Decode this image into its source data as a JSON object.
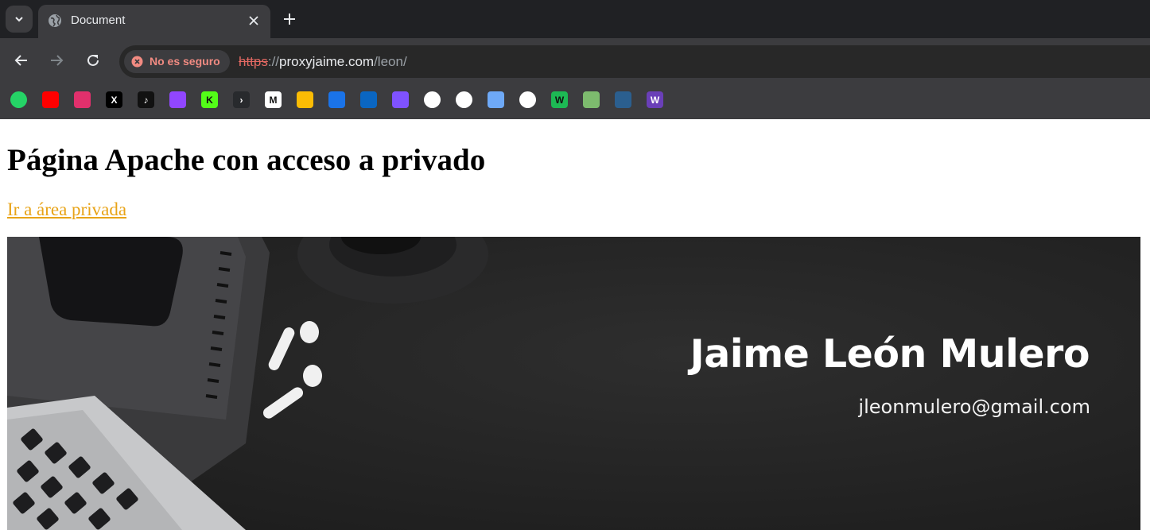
{
  "browser": {
    "tab": {
      "title": "Document"
    },
    "security_chip": {
      "label": "No es seguro"
    },
    "url": {
      "scheme": "https",
      "separator": "://",
      "host": "proxyjaime.com",
      "path": "/leon/"
    },
    "bookmarks": [
      {
        "name": "whatsapp-icon",
        "color": "#25d366",
        "glyph": ""
      },
      {
        "name": "youtube-icon",
        "color": "#ff0000",
        "glyph": ""
      },
      {
        "name": "instagram-icon",
        "color": "#e1306c",
        "glyph": ""
      },
      {
        "name": "x-icon",
        "color": "#000000",
        "glyph": "X"
      },
      {
        "name": "tiktok-icon",
        "color": "#111111",
        "glyph": "♪"
      },
      {
        "name": "twitch-icon",
        "color": "#9146ff",
        "glyph": ""
      },
      {
        "name": "kick-icon",
        "color": "#53fc18",
        "glyph": "K"
      },
      {
        "name": "plex-icon",
        "color": "#282a2d",
        "glyph": "›"
      },
      {
        "name": "gmail-icon",
        "color": "#ffffff",
        "glyph": "M"
      },
      {
        "name": "google-drive-icon",
        "color": "#fbbc04",
        "glyph": ""
      },
      {
        "name": "graduation-cap-icon",
        "color": "#1a73e8",
        "glyph": ""
      },
      {
        "name": "mail-icon",
        "color": "#0a66c2",
        "glyph": ""
      },
      {
        "name": "kotlin-icon",
        "color": "#7f52ff",
        "glyph": ""
      },
      {
        "name": "github-icon",
        "color": "#ffffff",
        "glyph": ""
      },
      {
        "name": "chatgpt-icon",
        "color": "#ffffff",
        "glyph": ""
      },
      {
        "name": "copilot-icon",
        "color": "#6ea9f7",
        "glyph": ""
      },
      {
        "name": "clock-check-icon",
        "color": "#ffffff",
        "glyph": ""
      },
      {
        "name": "w-logo-icon",
        "color": "#1db954",
        "glyph": "W"
      },
      {
        "name": "leaf-icon",
        "color": "#7dbb6e",
        "glyph": ""
      },
      {
        "name": "globe-blue-icon",
        "color": "#2b5f8f",
        "glyph": ""
      },
      {
        "name": "w-purple-icon",
        "color": "#6a3fb8",
        "glyph": "W"
      }
    ]
  },
  "page": {
    "heading": "Página Apache con acceso a privado",
    "link_text": "Ir a área privada",
    "banner": {
      "name": "Jaime León Mulero",
      "email": "jleonmulero@gmail.com"
    }
  }
}
